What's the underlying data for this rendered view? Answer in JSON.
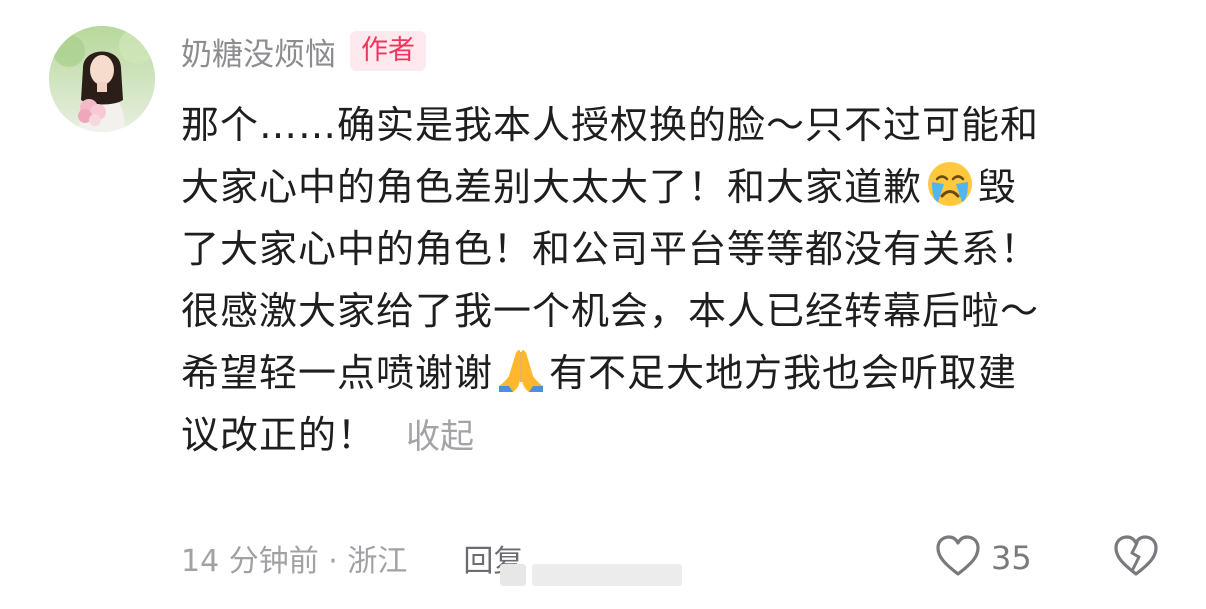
{
  "comment": {
    "author": {
      "name": "奶糖没烦恼",
      "badge": "作者"
    },
    "lines": {
      "l1": "那个……确实是我本人授权换的脸～只不过可能和",
      "l2a": "大家心中的角色差别大太大了！和大家道歉",
      "l2b": "毁",
      "l3": "了大家心中的角色！和公司平台等等都没有关系！",
      "l4": "很感激大家给了我一个机会，本人已经转幕后啦～",
      "l5a": "希望轻一点喷谢谢",
      "l5b": "有不足大地方我也会听取建",
      "l6": "议改正的！"
    },
    "emojis": {
      "crying": "crying-face-emoji",
      "folded_hands": "folded-hands-emoji"
    },
    "collapse_label": "收起",
    "meta": "14 分钟前 · 浙江",
    "reply_label": "回复",
    "like_count": "35",
    "icons": {
      "like": "heart-icon",
      "dislike": "broken-heart-icon"
    },
    "colors": {
      "badge_bg": "#fde9ee",
      "badge_text": "#f0365f",
      "secondary_text": "#a1a1a6"
    }
  }
}
